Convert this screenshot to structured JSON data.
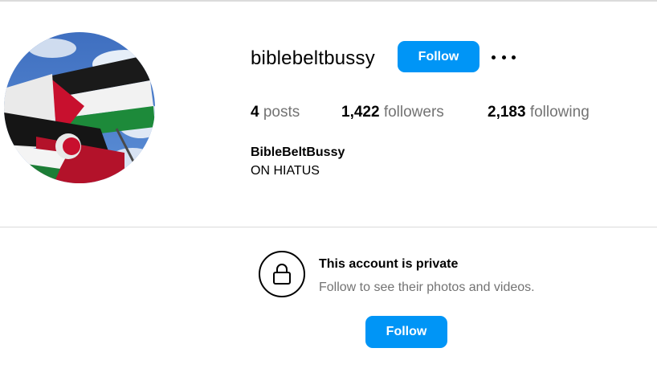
{
  "profile": {
    "username": "biblebeltbussy",
    "follow_label": "Follow",
    "more_icon": "more-options-icon",
    "avatar_alt": "profile picture"
  },
  "stats": {
    "posts_count": "4",
    "posts_label": "posts",
    "followers_count": "1,422",
    "followers_label": "followers",
    "following_count": "2,183",
    "following_label": "following"
  },
  "bio": {
    "display_name": "BibleBeltBussy",
    "text": "ON HIATUS"
  },
  "private": {
    "icon": "lock-icon",
    "title": "This account is private",
    "subtitle": "Follow to see their photos and videos.",
    "follow_label": "Follow"
  },
  "colors": {
    "primary_button": "#0095f6",
    "muted_text": "#737373",
    "divider": "#dbdbdb"
  }
}
